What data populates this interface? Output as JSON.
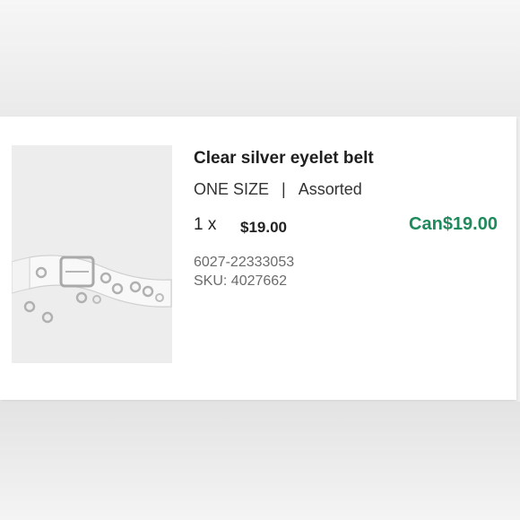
{
  "item": {
    "title": "Clear silver eyelet belt",
    "size": "ONE SIZE",
    "separator": "|",
    "color": "Assorted",
    "quantity": "1 x",
    "unit_price": "$19.00",
    "line_total": "Can$19.00",
    "product_code": "6027-22333053",
    "sku": "SKU: 4027662",
    "image_icon": "clear-belt-product-image"
  },
  "colors": {
    "total_green": "#1f8a5c",
    "thumb_bg": "#ededed"
  }
}
